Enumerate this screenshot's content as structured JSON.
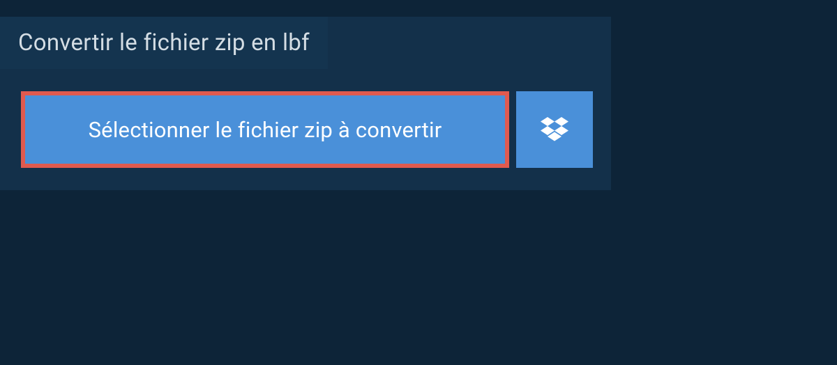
{
  "title": "Convertir le fichier zip en lbf",
  "select_button_label": "Sélectionner le fichier zip à convertir",
  "colors": {
    "background": "#0d2438",
    "panel": "#13304a",
    "tab": "#14344f",
    "button": "#4a90d9",
    "highlight_border": "#e05a4f",
    "text_light": "#d4dde4",
    "text_white": "#ffffff"
  }
}
